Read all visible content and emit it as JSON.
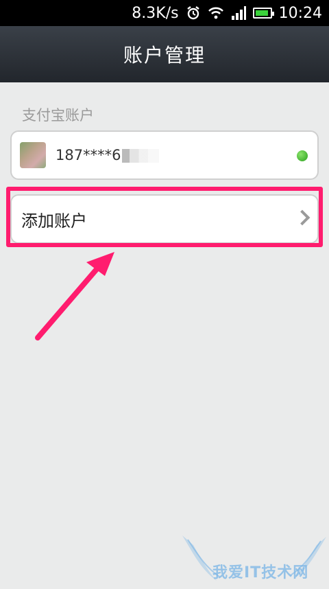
{
  "status_bar": {
    "speed": "8.3K/s",
    "time": "10:24",
    "battery_level": 0.9,
    "colors": {
      "battery": "#3bd33b"
    }
  },
  "header": {
    "title": "账户管理"
  },
  "section": {
    "label": "支付宝账户"
  },
  "account": {
    "number": "187****6",
    "status_color": "#2aa11e"
  },
  "add_account": {
    "label": "添加账户"
  },
  "annotation": {
    "color": "#ff1c6e"
  },
  "watermark": {
    "text": "我爱IT技术网"
  }
}
